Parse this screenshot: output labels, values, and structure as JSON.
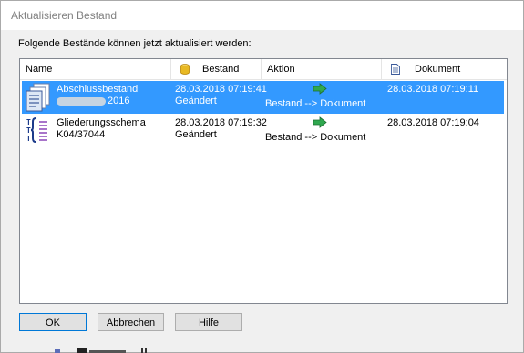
{
  "dialog": {
    "title": "Aktualisieren Bestand",
    "instruction": "Folgende Bestände können jetzt aktualisiert werden:"
  },
  "columns": {
    "name": "Name",
    "bestand": "Bestand",
    "aktion": "Aktion",
    "dokument": "Dokument"
  },
  "rows": [
    {
      "name_line1": "Abschlussbestand",
      "name_line2": "2016",
      "bestand_time": "28.03.2018 07:19:41",
      "bestand_status": "Geändert",
      "aktion": "Bestand --> Dokument",
      "dokument_time": "28.03.2018 07:19:11",
      "icon": "document-stack-icon",
      "selected": true
    },
    {
      "name_line1": "Gliederungsschema",
      "name_line2": "K04/37044",
      "bestand_time": "28.03.2018 07:19:32",
      "bestand_status": "Geändert",
      "aktion": "Bestand --> Dokument",
      "dokument_time": "28.03.2018 07:19:04",
      "icon": "outline-schema-icon",
      "selected": false
    }
  ],
  "buttons": {
    "ok": "OK",
    "cancel": "Abbrechen",
    "help": "Hilfe"
  },
  "colors": {
    "selection": "#3399ff",
    "arrow": "#2fa84f",
    "database": "#e8b923"
  }
}
